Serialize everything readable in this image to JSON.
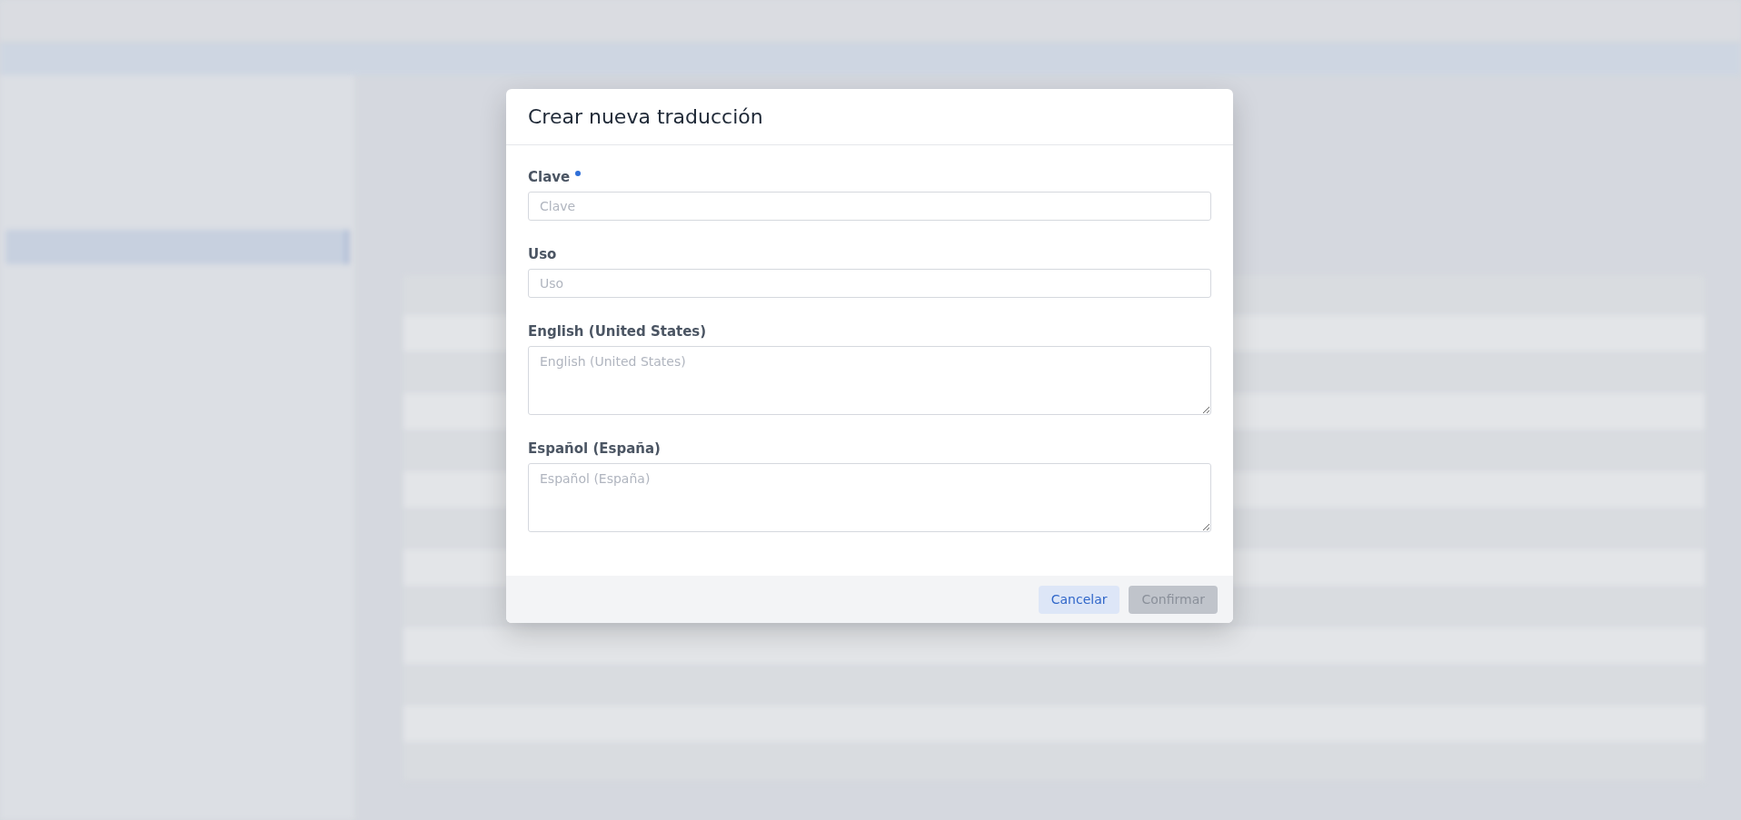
{
  "dialog": {
    "title": "Crear nueva traducción",
    "fields": [
      {
        "label": "Clave",
        "placeholder": "Clave",
        "kind": "input",
        "required": true
      },
      {
        "label": "Uso",
        "placeholder": "Uso",
        "kind": "input",
        "required": false
      },
      {
        "label": "English (United States)",
        "placeholder": "English (United States)",
        "kind": "textarea",
        "required": false
      },
      {
        "label": "Español (España)",
        "placeholder": "Español (España)",
        "kind": "textarea",
        "required": false
      }
    ],
    "buttons": [
      {
        "label": "Cancelar",
        "kind": "secondary",
        "disabled": false
      },
      {
        "label": "Confirmar",
        "kind": "primary",
        "disabled": true
      }
    ]
  }
}
